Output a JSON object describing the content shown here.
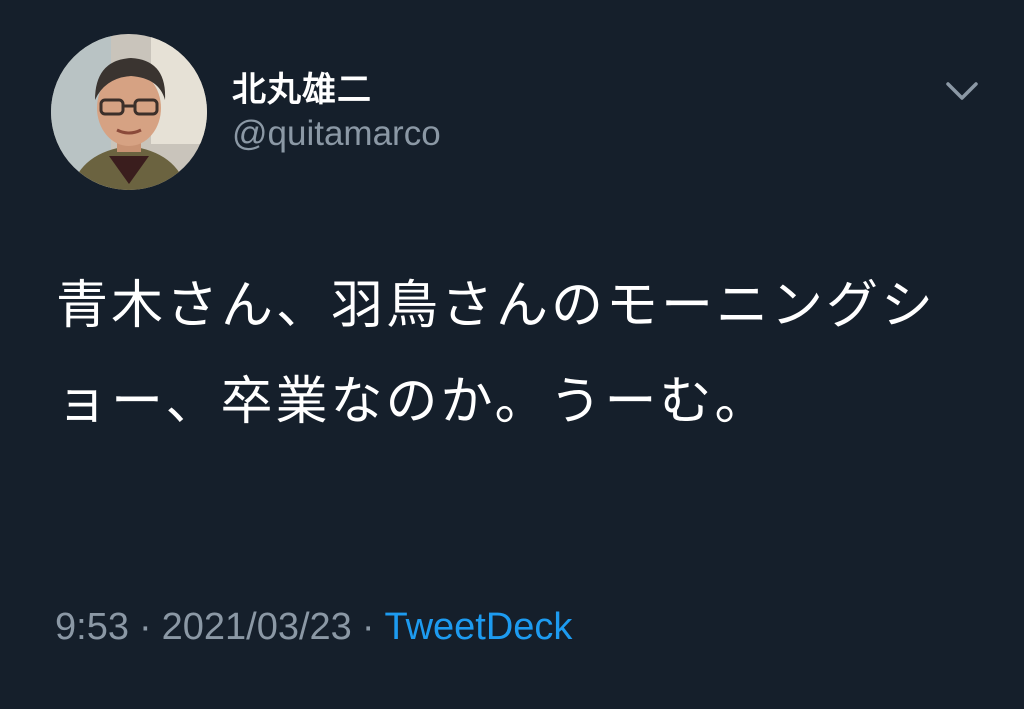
{
  "tweet": {
    "author": {
      "display_name": "北丸雄二",
      "handle": "@quitamarco",
      "avatar_icon": "user-avatar-photo"
    },
    "menu_icon": "chevron-down-icon",
    "text": "青木さん、羽鳥さんのモーニングショー、卒業なのか。うーむ。",
    "time": "9:53",
    "date": "2021/03/23",
    "separator": "·",
    "source": "TweetDeck"
  },
  "colors": {
    "background": "#151f2b",
    "text": "#ffffff",
    "secondary_text": "#8b98a5",
    "link": "#1d9bf0"
  }
}
